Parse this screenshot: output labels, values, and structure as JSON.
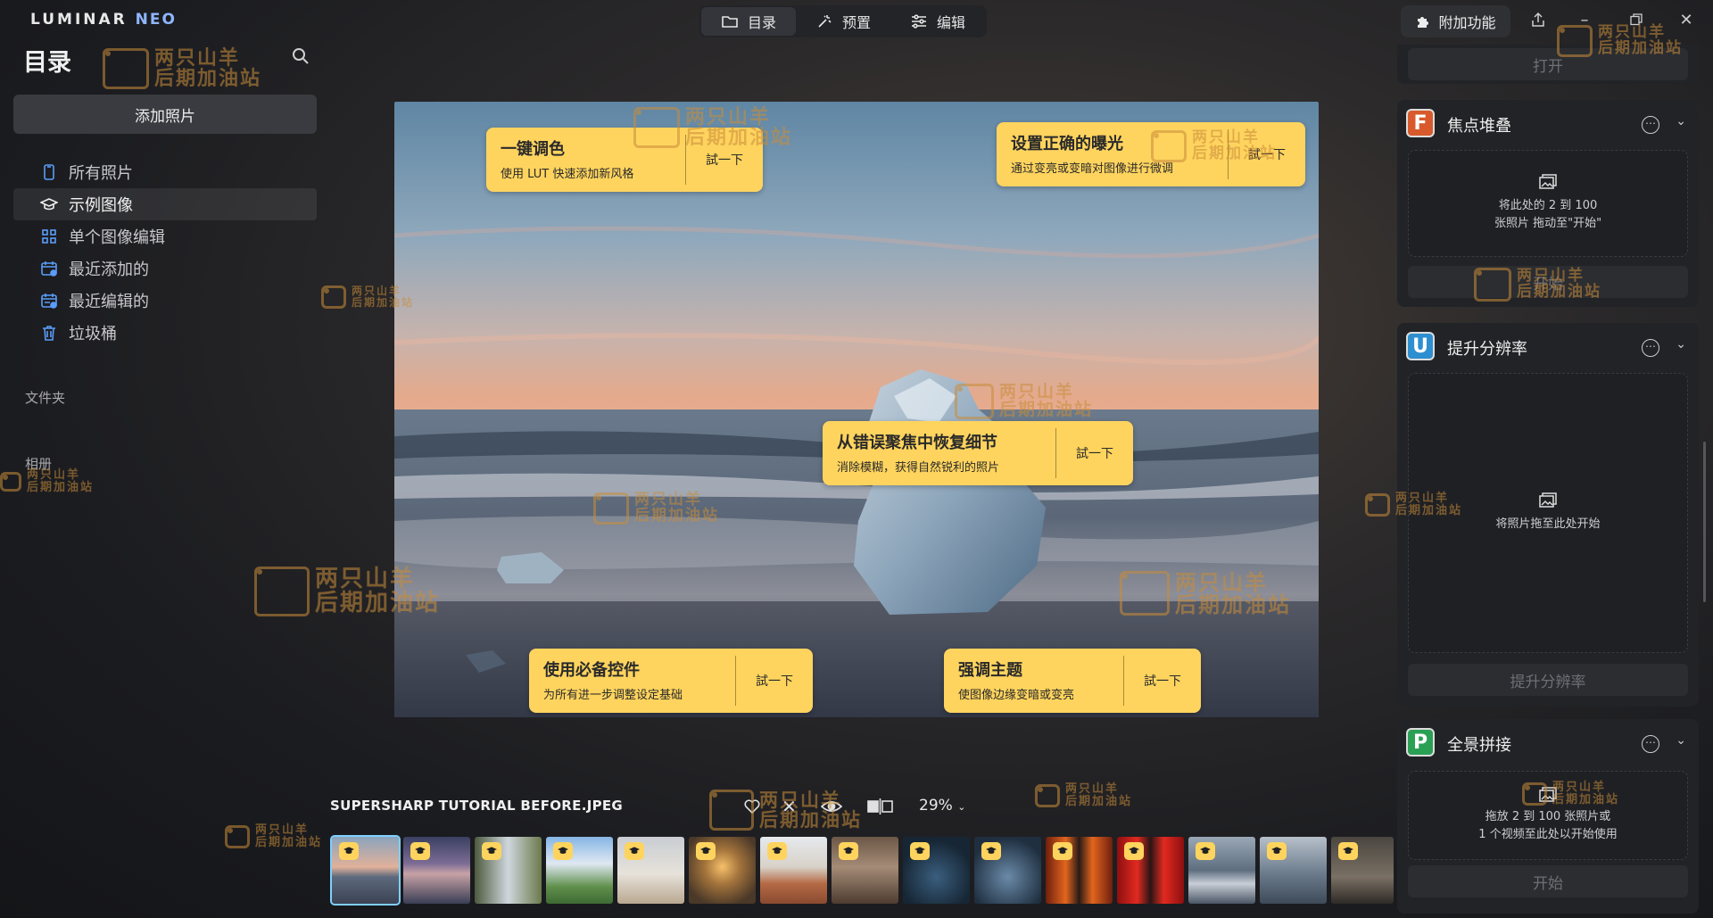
{
  "app": {
    "logo_main": "LUMINAR",
    "logo_sub": "NEO"
  },
  "topnav": {
    "catalog": "目录",
    "presets": "预置",
    "edit": "编辑"
  },
  "addons_label": "附加功能",
  "sidebar": {
    "title": "目录",
    "add_photos": "添加照片",
    "items": [
      {
        "label": "所有照片",
        "icon": "phone-icon"
      },
      {
        "label": "示例图像",
        "icon": "graduation-cap-icon"
      },
      {
        "label": "单个图像编辑",
        "icon": "grid-icon"
      },
      {
        "label": "最近添加的",
        "icon": "calendar-add-icon"
      },
      {
        "label": "最近编辑的",
        "icon": "calendar-edit-icon"
      },
      {
        "label": "垃圾桶",
        "icon": "trash-icon"
      }
    ],
    "folders_label": "文件夹",
    "albums_label": "相册"
  },
  "tips": [
    {
      "title": "一键调色",
      "desc": "使用 LUT 快速添加新风格",
      "button": "試一下"
    },
    {
      "title": "设置正确的曝光",
      "desc": "通过变亮或变暗对图像进行微调",
      "button": "試一下"
    },
    {
      "title": "从错误聚焦中恢复细节",
      "desc": "消除模糊，获得自然锐利的照片",
      "button": "試一下"
    },
    {
      "title": "使用必备控件",
      "desc": "为所有进一步调整设定基础",
      "button": "試一下"
    },
    {
      "title": "强调主题",
      "desc": "使图像边缘变暗或变亮",
      "button": "試一下"
    }
  ],
  "viewer": {
    "filename": "SUPERSHARP TUTORIAL BEFORE.JPEG",
    "zoom": "29%"
  },
  "filmstrip_count": 15,
  "panels": {
    "top_button": "打开",
    "focus_stack": {
      "badge": "F",
      "title": "焦点堆叠",
      "drop_line1": "将此处的 2 到 100",
      "drop_line2": "张照片 拖动至\"开始\"",
      "button": "开始"
    },
    "supersharp": {
      "badge": "U",
      "title": "提升分辨率",
      "drop_line1": "将照片拖至此处开始",
      "button": "提升分辨率"
    },
    "panorama": {
      "badge": "P",
      "title": "全景拼接",
      "drop_line1": "拖放 2 到 100 张照片或",
      "drop_line2": "1 个视频至此处以开始使用",
      "button": "开始"
    }
  },
  "watermark": {
    "line1": "两只山羊",
    "line2": "后期加油站"
  },
  "colors": {
    "accent_yellow": "#ffd45e",
    "focus_badge": "#d85a2c",
    "upscale_badge": "#2d8fd0",
    "pano_badge": "#2aa055"
  }
}
